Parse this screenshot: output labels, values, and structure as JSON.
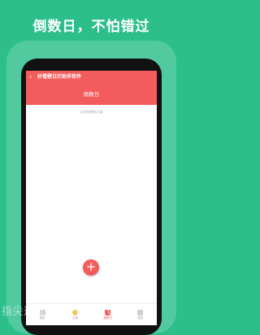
{
  "promo": {
    "headline": "倒数日，不怕错过"
  },
  "app": {
    "title": "好看壁日历助手软件",
    "page_title": "倒数日",
    "empty_hint": "还没有删除记录",
    "fab_label": "+"
  },
  "tabbar": {
    "tabs": [
      {
        "label": "首页",
        "icon": "home-icon"
      },
      {
        "label": "心情",
        "icon": "smile-icon"
      },
      {
        "label": "倒数日",
        "icon": "countdown-icon"
      },
      {
        "label": "更多",
        "icon": "more-icon"
      }
    ]
  },
  "watermark": "指尖运软件 · ZJNHB.COM",
  "colors": {
    "background": "#2dbf8b",
    "accent": "#f25c5c",
    "smile": "#f7c04a"
  }
}
